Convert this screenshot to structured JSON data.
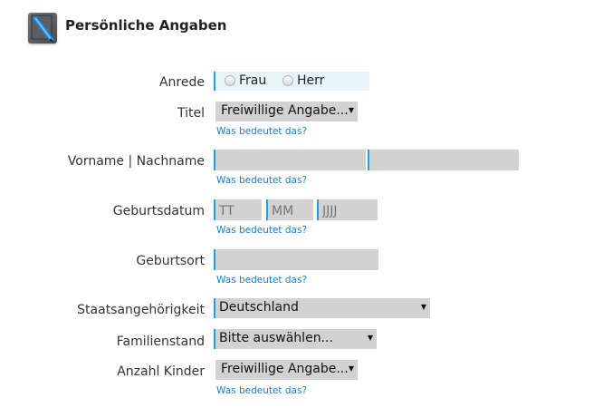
{
  "header": {
    "title": "Persönliche Angaben",
    "icon": "pen-edit-icon"
  },
  "help_text": "Was bedeutet das?",
  "anrede": {
    "label": "Anrede",
    "options": [
      "Frau",
      "Herr"
    ]
  },
  "titel": {
    "label": "Titel",
    "value": "Freiwillige Angabe..."
  },
  "name": {
    "label": "Vorname | Nachname"
  },
  "geburtsdatum": {
    "label": "Geburtsdatum",
    "day_placeholder": "TT",
    "month_placeholder": "MM",
    "year_placeholder": "JJJJ"
  },
  "geburtsort": {
    "label": "Geburtsort"
  },
  "staatsangehoerigkeit": {
    "label": "Staatsangehörigkeit",
    "value": "Deutschland"
  },
  "familienstand": {
    "label": "Familienstand",
    "value": "Bitte auswählen..."
  },
  "kinder": {
    "label": "Anzahl Kinder",
    "value": "Freiwillige Angabe..."
  },
  "colors": {
    "accent": "#1aa3e8",
    "link": "#1a7fc2",
    "field_bg": "#d2d2d2"
  }
}
